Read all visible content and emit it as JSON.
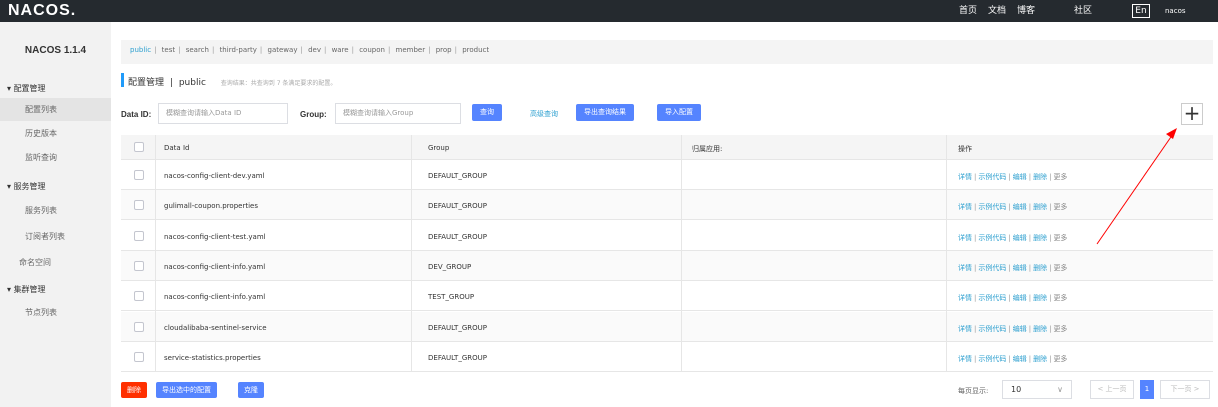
{
  "header": {
    "logo": "NACOS.",
    "nav": [
      "首页",
      "文档",
      "博客",
      "社区"
    ],
    "lang": "En",
    "user": "nacos"
  },
  "sidebar": {
    "version": "NACOS 1.1.4",
    "groups": [
      {
        "label": "配置管理",
        "items": [
          "配置列表",
          "历史版本",
          "监听查询"
        ]
      },
      {
        "label": "服务管理",
        "items": [
          "服务列表",
          "订阅者列表"
        ]
      },
      {
        "label": "命名空间"
      },
      {
        "label": "集群管理",
        "items": [
          "节点列表"
        ]
      }
    ]
  },
  "namespaces": [
    "public",
    "test",
    "search",
    "third-party",
    "gateway",
    "dev",
    "ware",
    "coupon",
    "member",
    "prop",
    "product"
  ],
  "title": {
    "main": "配置管理",
    "sep": "|",
    "ns": "public",
    "hint": "查询结果：共查询到 7 条满足要求的配置。"
  },
  "search": {
    "dataid_label": "Data ID:",
    "dataid_placeholder": "模糊查询请输入Data ID",
    "group_label": "Group:",
    "group_placeholder": "模糊查询请输入Group",
    "query_btn": "查询",
    "advanced_link": "高级查询",
    "export_btn": "导出查询结果",
    "import_btn": "导入配置",
    "add_btn": "+"
  },
  "table": {
    "headers": [
      "Data Id",
      "Group",
      "归属应用:",
      "操作"
    ],
    "rows": [
      {
        "data_id": "nacos-config-client-dev.yaml",
        "group": "DEFAULT_GROUP",
        "app": ""
      },
      {
        "data_id": "gulimall-coupon.properties",
        "group": "DEFAULT_GROUP",
        "app": ""
      },
      {
        "data_id": "nacos-config-client-test.yaml",
        "group": "DEFAULT_GROUP",
        "app": ""
      },
      {
        "data_id": "nacos-config-client-info.yaml",
        "group": "DEV_GROUP",
        "app": ""
      },
      {
        "data_id": "nacos-config-client-info.yaml",
        "group": "TEST_GROUP",
        "app": ""
      },
      {
        "data_id": "cloudalibaba-sentinel-service",
        "group": "DEFAULT_GROUP",
        "app": ""
      },
      {
        "data_id": "service-statistics.properties",
        "group": "DEFAULT_GROUP",
        "app": ""
      }
    ],
    "ops": {
      "detail": "详情",
      "sample": "示例代码",
      "edit": "编辑",
      "delete": "删除",
      "more": "更多"
    }
  },
  "footer": {
    "delete_btn": "删除",
    "export_selected_btn": "导出选中的配置",
    "clone_btn": "克隆",
    "per_page_label": "每页显示:",
    "per_page_value": "10",
    "prev": "< 上一页",
    "current_page": "1",
    "next": "下一页 >"
  },
  "colors": {
    "primary": "#5584ff",
    "link": "#2ea0d0",
    "danger": "#ff3000",
    "topbar": "#252a2f",
    "annotation": "#ff0000"
  }
}
